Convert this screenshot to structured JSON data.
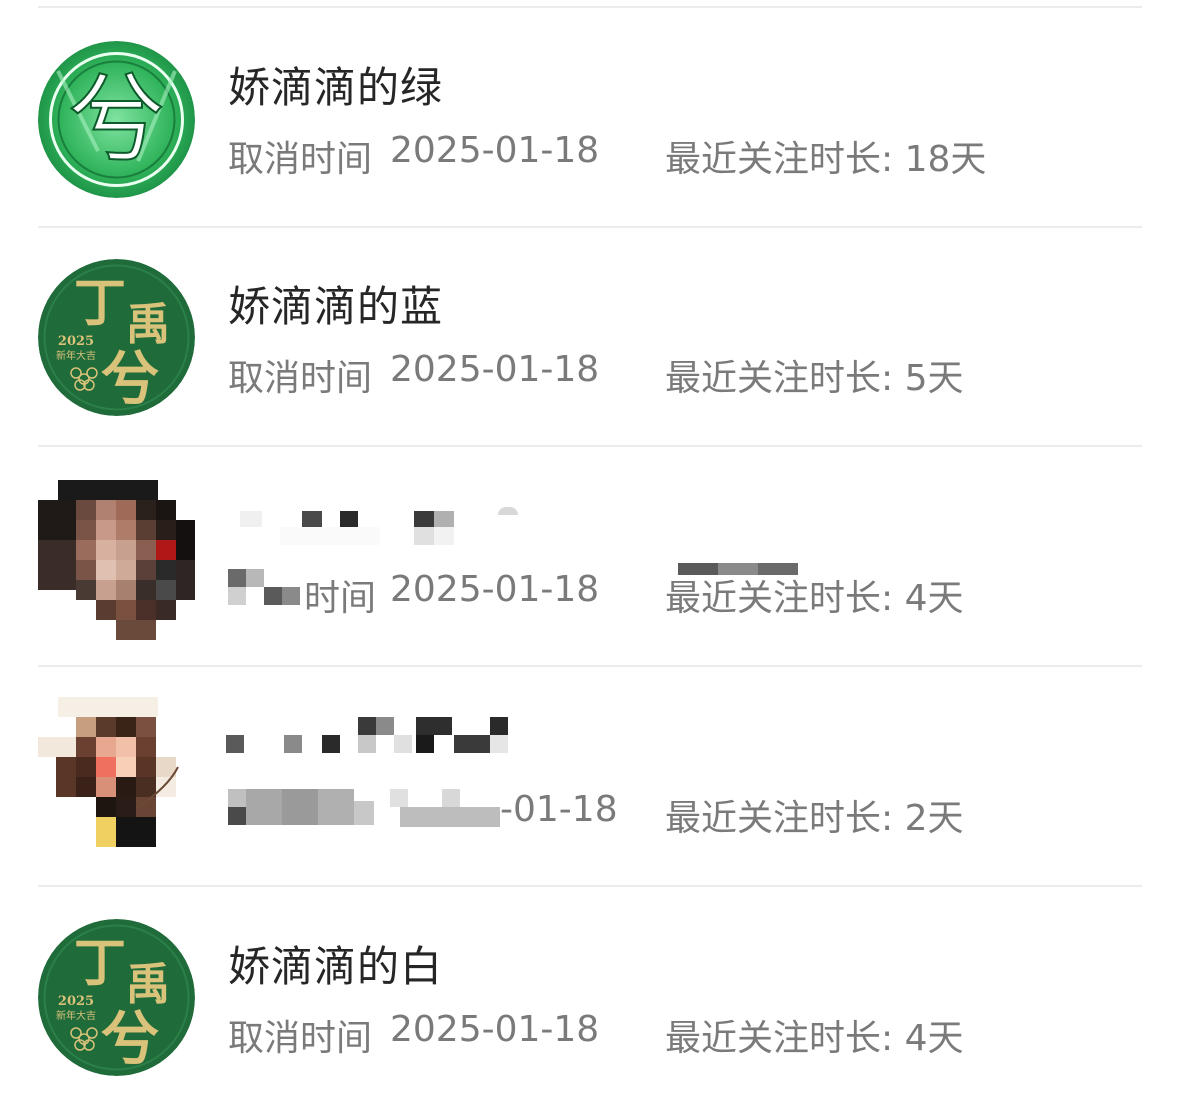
{
  "items": [
    {
      "name": "娇滴滴的绿",
      "cancel_label": "取消时间",
      "cancel_date": "2025-01-18",
      "duration_label": "最近关注时长:",
      "duration_value": "18天",
      "avatar": "green-badge-avatar",
      "avatar_text": "兮"
    },
    {
      "name": "娇滴滴的蓝",
      "cancel_label": "取消时间",
      "cancel_date": "2025-01-18",
      "duration_label": "最近关注时长:",
      "duration_value": "5天",
      "avatar": "dark-green-seal-avatar",
      "avatar_text": [
        "丁",
        "禹",
        "兮",
        "2025",
        "新年大吉"
      ]
    },
    {
      "name": "",
      "cancel_label": "时间",
      "cancel_date": "2025-01-18",
      "duration_label": "最近关注时长:",
      "duration_value": "4天",
      "avatar": "pixelated-photo-avatar",
      "avatar_text": null
    },
    {
      "name": "",
      "cancel_label": "",
      "cancel_date": "-01-18",
      "duration_label": "最近关注时长:",
      "duration_value": "2天",
      "avatar": "pixelated-photo-avatar",
      "avatar_text": null
    },
    {
      "name": "娇滴滴的白",
      "cancel_label": "取消时间",
      "cancel_date": "2025-01-18",
      "duration_label": "最近关注时长:",
      "duration_value": "4天",
      "avatar": "dark-green-seal-avatar",
      "avatar_text": [
        "丁",
        "禹",
        "兮",
        "2025",
        "新年大吉"
      ]
    }
  ],
  "colors": {
    "name_text": "#262626",
    "meta_text": "#7a7a7a",
    "separator": "#ececec",
    "seal_green": "#1f6b3a",
    "seal_gold": "#d9c27a",
    "badge_green": "#2fb35a"
  }
}
